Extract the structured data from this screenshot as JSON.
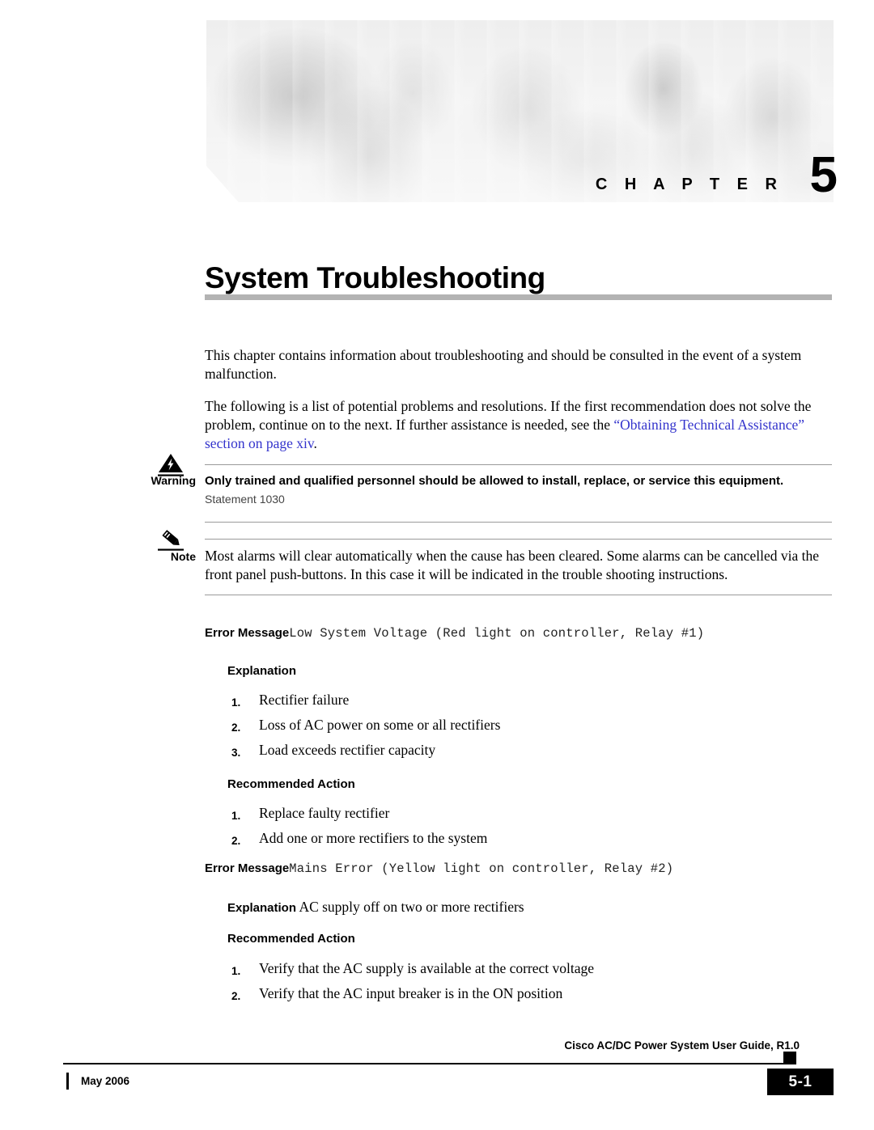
{
  "banner": {
    "chapter_word": "C H A P T E R",
    "chapter_number": "5",
    "photo_alt": "grayscale-photo-montage-people-networking-equipment"
  },
  "chapter_title": "System Troubleshooting",
  "intro": {
    "para1": "This chapter contains information about troubleshooting and should be consulted in the event of a system malfunction.",
    "para2_before": "The following is a list of potential problems and resolutions. If the first recommendation does not solve the problem, continue on to the next. If further assistance is needed, see the ",
    "para2_link": "“Obtaining Technical Assistance” section on page xiv",
    "para2_after": "."
  },
  "warning": {
    "label": "Warning",
    "icon": "warning-triangle-lightning-icon",
    "text": "Only trained and qualified personnel should be allowed to install, replace, or service this equipment.",
    "statement": "Statement 1030"
  },
  "note": {
    "label": "Note",
    "icon": "pencil-icon",
    "text": "Most alarms will clear automatically when the cause has been cleared. Some alarms can be cancelled via the front panel push-buttons. In this case it will be indicated in the trouble shooting instructions."
  },
  "errors": [
    {
      "label": "Error Message",
      "message": "Low System Voltage (Red light on controller, Relay #1)",
      "explanation_head": "Explanation",
      "explanation_items": [
        {
          "num": "1.",
          "text": "Rectifier failure"
        },
        {
          "num": "2.",
          "text": "Loss of AC power on some or all rectifiers"
        },
        {
          "num": "3.",
          "text": "Load exceeds rectifier capacity"
        }
      ],
      "action_head": "Recommended Action",
      "action_items": [
        {
          "num": "1.",
          "text": "Replace faulty rectifier"
        },
        {
          "num": "2.",
          "text": "Add one or more rectifiers to the system"
        }
      ]
    },
    {
      "label": "Error Message",
      "message": "Mains Error (Yellow light on controller, Relay #2)",
      "explanation_head": "Explanation",
      "explanation_inline": "AC supply off on two or more rectifiers",
      "action_head": "Recommended Action",
      "action_items": [
        {
          "num": "1.",
          "text": "Verify that the AC supply is available at the correct voltage"
        },
        {
          "num": "2.",
          "text": "Verify that the AC input breaker is in the ON position"
        }
      ]
    }
  ],
  "footer": {
    "guide": "Cisco AC/DC Power System User Guide, R1.0",
    "date": "May 2006",
    "page": "5-1"
  },
  "colors": {
    "link": "#3333CC",
    "rule": "#B3B3B3",
    "text": "#000000"
  }
}
